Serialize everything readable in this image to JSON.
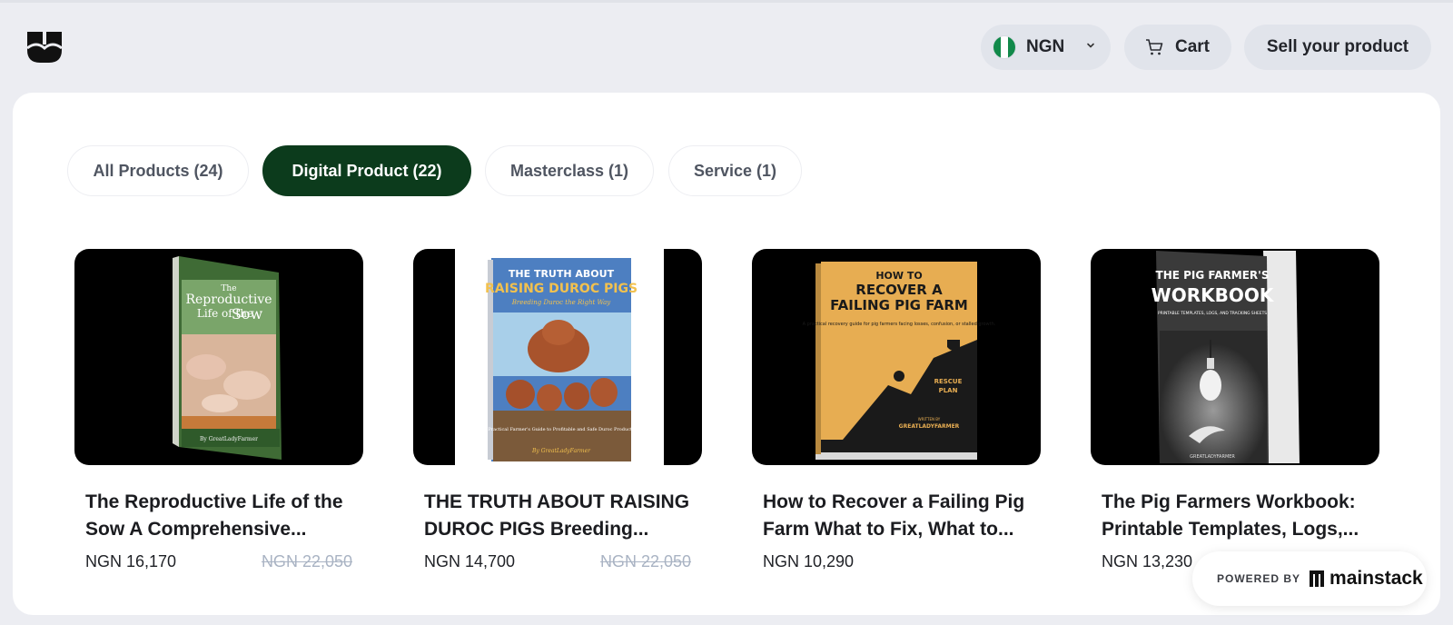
{
  "header": {
    "logo_icon": "mainstack-store-logo-icon",
    "currency": {
      "code": "NGN",
      "flag": [
        "#11894a",
        "#ffffff",
        "#11894a"
      ],
      "chevron_icon": "chevron-down-icon"
    },
    "cart": {
      "label": "Cart",
      "icon": "cart-icon"
    },
    "sell": {
      "label": "Sell your product"
    }
  },
  "tabs": [
    {
      "label": "All Products (24)",
      "active": false
    },
    {
      "label": "Digital Product (22)",
      "active": true
    },
    {
      "label": "Masterclass (1)",
      "active": false
    },
    {
      "label": "Service (1)",
      "active": false
    }
  ],
  "products": [
    {
      "title": "The Reproductive Life of the Sow A Comprehensive...",
      "price": "NGN 16,170",
      "old_price": "NGN 22,050",
      "cover": {
        "title_lines": [
          "The",
          "Reproductive",
          "Life of the",
          "Sow"
        ],
        "author": "By GreatLadyFarmer"
      }
    },
    {
      "title": "THE TRUTH ABOUT RAISING DUROC PIGS Breeding...",
      "price": "NGN 14,700",
      "old_price": "NGN 22,050",
      "cover": {
        "title_lines": [
          "THE TRUTH ABOUT",
          "RAISING DUROC PIGS"
        ],
        "subtitle": "Breeding Duroc the Right Way",
        "tagline": "A Practical Farmer's Guide to Profitable and Safe Duroc Production",
        "author": "By GreatLadyFarmer"
      }
    },
    {
      "title": "How to Recover a Failing Pig Farm What to Fix, What to...",
      "price": "NGN 10,290",
      "old_price": "",
      "cover": {
        "title_lines": [
          "HOW TO",
          "RECOVER A",
          "FAILING PIG FARM"
        ],
        "tagline": "A practical recovery guide for pig farmers facing losses, confusion, or stalled growth.",
        "badge": [
          "RESCUE",
          "PLAN"
        ],
        "author_prefix": "WRITTEN BY",
        "author": "GREATLADYFARMER"
      }
    },
    {
      "title": "The Pig Farmers Workbook: Printable Templates, Logs,...",
      "price": "NGN 13,230",
      "old_price": "",
      "cover": {
        "title_lines": [
          "THE PIG FARMER'S",
          "WORKBOOK"
        ],
        "subtitle": "PRINTABLE TEMPLATES, LOGS, AND TRACKING SHEETS",
        "author": "GREATLADYFARMER"
      }
    }
  ],
  "powered": {
    "prefix": "POWERED BY",
    "brand": "mainstack"
  }
}
